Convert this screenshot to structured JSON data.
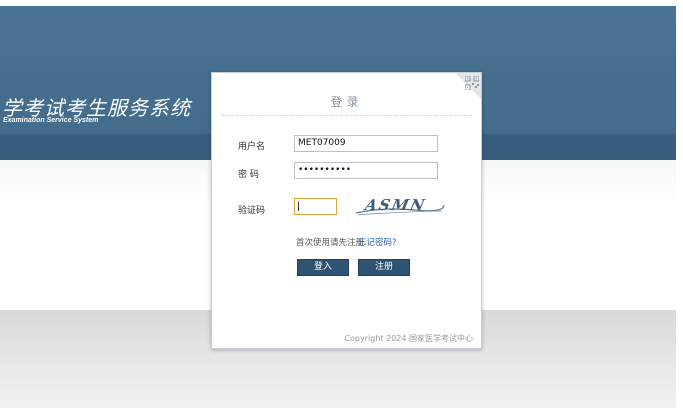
{
  "brand": {
    "title": "学考试考生服务系统",
    "subtitle": "Examination Service System"
  },
  "login": {
    "title": "登录",
    "username_label": "用户名",
    "username_value": "MET07009",
    "password_label": "密 码",
    "password_value": "••••••••••",
    "captcha_label": "验证码",
    "captcha_value": "",
    "captcha_image_text": "ASMN",
    "first_use_note": "首次使用请先注册",
    "forgot_link": "忘记密码?",
    "login_button": "登入",
    "register_button": "注册",
    "copyright": "Copyright 2024 国家医学考试中心"
  },
  "icons": {
    "corner": "qr-code-icon"
  },
  "colors": {
    "header": "#4a7394",
    "header_band": "#385e7d",
    "button": "#2f5473",
    "link": "#2b6ba8",
    "captcha_focus_border": "#e3a33a"
  }
}
